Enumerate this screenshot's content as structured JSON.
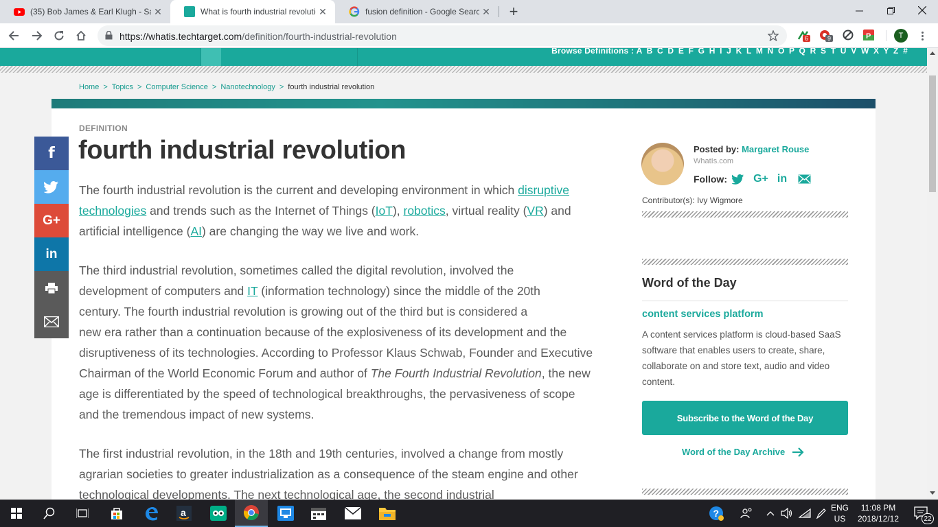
{
  "browser": {
    "tabs": [
      {
        "title": "(35) Bob James & Earl Klugh - Sa",
        "active": false
      },
      {
        "title": "What is fourth industrial revolutio",
        "active": true
      },
      {
        "title": "fusion definition - Google Search",
        "active": false
      }
    ],
    "new_tab": "+",
    "url_host": "https://whatis.techtarget.com",
    "url_path": "/definition/fourth-industrial-revolution",
    "ext_badges": [
      "6",
      "9"
    ],
    "profile_initial": "T"
  },
  "site": {
    "browse_label": "Browse Definitions :",
    "browse_letters": "A B C D E F G H I J K L M N O P Q R S T U V W X Y Z #",
    "accent": "#1aa99c"
  },
  "breadcrumb": {
    "items": [
      "Home",
      "Topics",
      "Computer Science",
      "Nanotechnology"
    ],
    "current": "fourth industrial revolution",
    "sep": ">"
  },
  "article": {
    "label": "DEFINITION",
    "title": "fourth industrial revolution",
    "p1": {
      "t1": "The fourth industrial revolution is the current  and developing environment in which ",
      "l1": "disruptive technologies",
      "t2": " and trends such as the Internet of Things (",
      "l2": "IoT",
      "t3": "), ",
      "l3": "robotics",
      "t4": ", virtual reality (",
      "l4": "VR",
      "t5": ") and artificial intelligence (",
      "l5": "AI",
      "t6": ") are changing the way we live and work."
    },
    "p2": {
      "line1": "The third industrial revolution, sometimes called the digital revolution, involved the",
      "t1": "development of computers and ",
      "l1": "IT",
      "t2": " (information technology) since the middle of the 20th",
      "line3": "century. The fourth industrial revolution is growing out of the third but is considered a",
      "t3": "new era rather than a continuation because of the explosiveness of its development and the disruptiveness of its technologies. According to Professor Klaus Schwab, Founder and Executive Chairman of the World Economic Forum and author of ",
      "em": "The Fourth Industrial Revolution",
      "t4": ", the new age is differentiated by the speed of technological breakthroughs, the pervasiveness of scope and the tremendous impact of new systems."
    },
    "p3": "The first industrial revolution, in the 18th and 19th centuries, involved a change from mostly agrarian societies to greater industrialization as a consequence of the steam engine and other technological developments. The next technological age, the second industrial"
  },
  "social": [
    {
      "name": "facebook",
      "glyph": "f",
      "color": "#3b5998"
    },
    {
      "name": "twitter",
      "glyph": "🐦",
      "color": "#55acee"
    },
    {
      "name": "google-plus",
      "glyph": "G+",
      "color": "#dd4b39"
    },
    {
      "name": "linkedin",
      "glyph": "in",
      "color": "#0e76a8"
    },
    {
      "name": "print",
      "glyph": "🖶",
      "color": "#5a5a5a"
    },
    {
      "name": "email",
      "glyph": "✉",
      "color": "#5a5a5a"
    }
  ],
  "author": {
    "posted_label": "Posted by:",
    "name": "Margaret Rouse",
    "source": "WhatIs.com",
    "follow_label": "Follow:",
    "contributors": "Contributor(s): Ivy Wigmore"
  },
  "word_of_day": {
    "heading": "Word of the Day",
    "term": "content services platform",
    "definition": "A content services platform is cloud-based SaaS software that enables users to create, share, collaborate on and store text, audio and video content.",
    "subscribe": "Subscribe to the Word of the Day",
    "archive": "Word of the Day Archive"
  },
  "taskbar": {
    "lang1": "ENG",
    "lang2": "US",
    "time": "11:08 PM",
    "date": "2018/12/12",
    "notifications": "22"
  }
}
